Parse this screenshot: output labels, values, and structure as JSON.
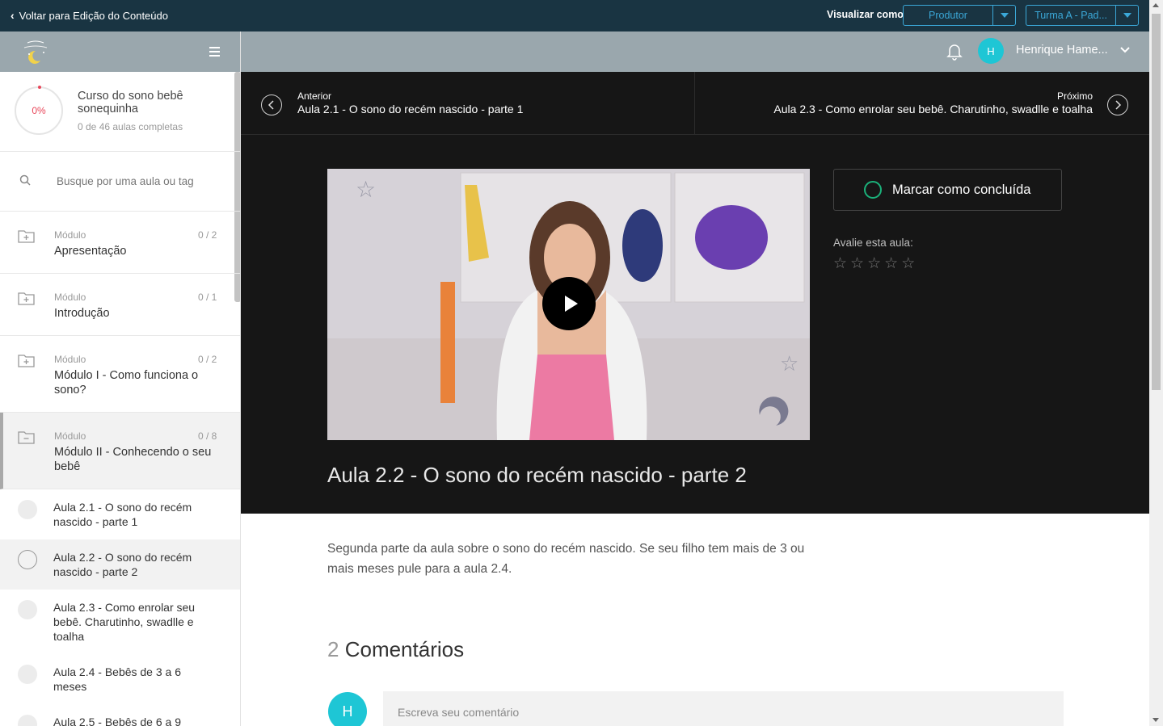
{
  "topbar": {
    "back_label": "Voltar para Edição do Conteúdo",
    "view_as_label": "Visualizar como",
    "role_select": "Produtor",
    "class_select": "Turma A - Pad..."
  },
  "sidebar": {
    "course": {
      "progress": "0%",
      "title": "Curso do sono bebê sonequinha",
      "completed": "0 de 46 aulas completas"
    },
    "search_placeholder": "Busque por uma aula ou tag",
    "modules": [
      {
        "label": "Módulo",
        "count": "0 / 2",
        "title": "Apresentação"
      },
      {
        "label": "Módulo",
        "count": "0 / 1",
        "title": "Introdução"
      },
      {
        "label": "Módulo",
        "count": "0 / 2",
        "title": "Módulo I - Como funciona o sono?"
      },
      {
        "label": "Módulo",
        "count": "0 / 8",
        "title": "Módulo II - Conhecendo o seu bebê"
      }
    ],
    "lessons": [
      {
        "title": "Aula 2.1 - O sono do recém nascido - parte 1"
      },
      {
        "title": "Aula 2.2 - O sono do recém nascido - parte 2"
      },
      {
        "title": "Aula 2.3 - Como enrolar seu bebê. Charutinho, swadlle e toalha"
      },
      {
        "title": "Aula 2.4 - Bebês de 3 a 6 meses"
      },
      {
        "title": "Aula 2.5 - Bebês de 6 a 9"
      }
    ]
  },
  "header": {
    "avatar_initial": "H",
    "user_name": "Henrique Hame..."
  },
  "nav": {
    "prev_kicker": "Anterior",
    "prev_title": "Aula 2.1 - O sono do recém nascido - parte 1",
    "next_kicker": "Próximo",
    "next_title": "Aula 2.3 - Como enrolar seu bebê. Charutinho, swadlle e toalha"
  },
  "lesson": {
    "title": "Aula 2.2 - O sono do recém nascido - parte 2",
    "mark_done": "Marcar como concluída",
    "rate_label": "Avalie esta aula:",
    "rating": 0,
    "rating_max": 5,
    "description": "Segunda parte da aula sobre o sono do recém nascido. Se seu filho tem mais de 3 ou mais meses pule para a aula 2.4."
  },
  "comments": {
    "count": "2",
    "heading": "Comentários",
    "avatar_initial": "H",
    "placeholder": "Escreva seu comentário"
  },
  "colors": {
    "topbar": "#193442",
    "accent_blue": "#3ba8d8",
    "avatar": "#1ec6d5",
    "done_green": "#1bb17a",
    "progress_red": "#e8475a"
  }
}
